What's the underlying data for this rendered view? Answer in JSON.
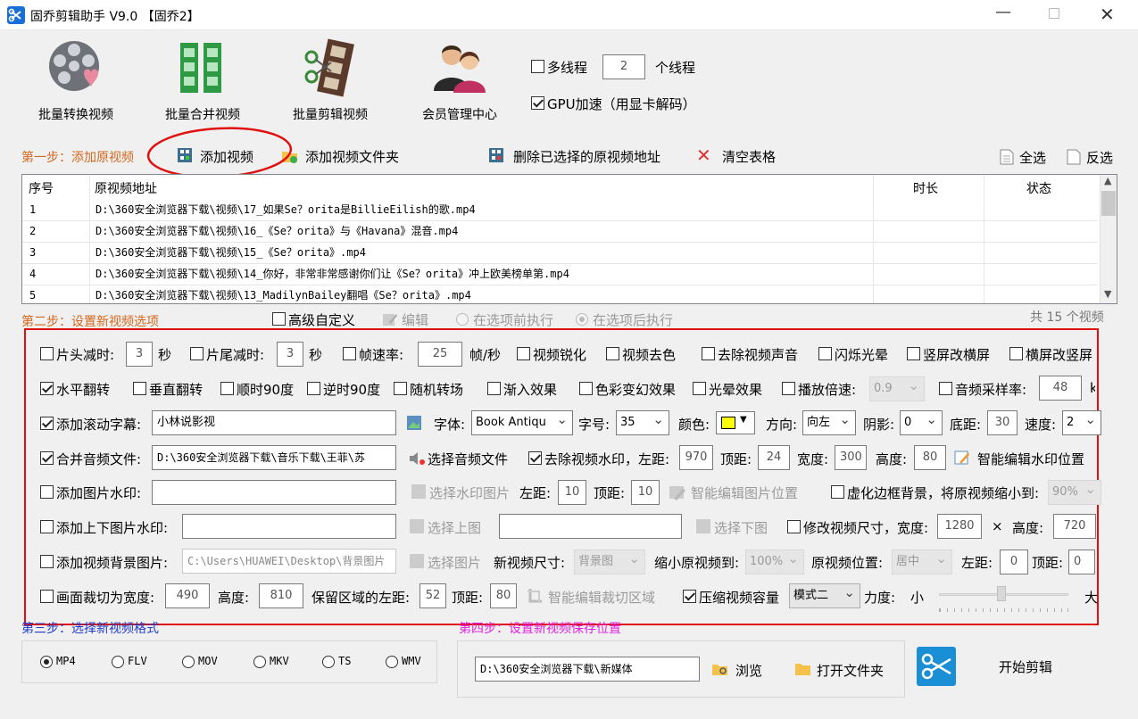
{
  "window": {
    "title": "固乔剪辑助手 V9.0 【固乔2】"
  },
  "toolbar": {
    "convert": "批量转换视频",
    "merge": "批量合并视频",
    "edit": "批量剪辑视频",
    "member": "会员管理中心",
    "multithread": "多线程",
    "threads": "2",
    "threads_unit": "个线程",
    "gpu": "GPU加速（用显卡解码）"
  },
  "step1": {
    "label": "第一步：添加原视频",
    "add_video": "添加视频",
    "add_folder": "添加视频文件夹",
    "delete_selected": "删除已选择的原视频地址",
    "clear": "清空表格",
    "select_all": "全选",
    "invert": "反选"
  },
  "table": {
    "headers": {
      "index": "序号",
      "path": "原视频地址",
      "duration": "时长",
      "status": "状态"
    },
    "rows": [
      {
        "index": "1",
        "path": "D:\\360安全浏览器下载\\视频\\17_如果Se？orita是BillieEilish的歌.mp4"
      },
      {
        "index": "2",
        "path": "D:\\360安全浏览器下载\\视频\\16_《Se？orita》与《Havana》混音.mp4"
      },
      {
        "index": "3",
        "path": "D:\\360安全浏览器下载\\视频\\15_《Se？orita》.mp4"
      },
      {
        "index": "4",
        "path": "D:\\360安全浏览器下载\\视频\\14_你好，非常非常感谢你们让《Se？orita》冲上欧美榜单第.mp4"
      },
      {
        "index": "5",
        "path": "D:\\360安全浏览器下载\\视频\\13_MadilynBailey翻唱《Se？orita》.mp4"
      }
    ]
  },
  "step2": {
    "label": "第二步：设置新视频选项",
    "advanced": "高级自定义",
    "edit": "编辑",
    "before": "在选项前执行",
    "after": "在选项后执行",
    "count": "共 15 个视频"
  },
  "opts": {
    "head_cut": "片头减时:",
    "head_val": "3",
    "sec1": "秒",
    "tail_cut": "片尾减时:",
    "tail_val": "3",
    "sec2": "秒",
    "fps": "帧速率:",
    "fps_val": "25",
    "fps_unit": "帧/秒",
    "sharpen": "视频锐化",
    "decolor": "视频去色",
    "remove_audio": "去除视频声音",
    "flash": "闪烁光晕",
    "to_landscape": "竖屏改横屏",
    "to_portrait": "横屏改竖屏",
    "hflip": "水平翻转",
    "vflip": "垂直翻转",
    "cw90": "顺时90度",
    "ccw90": "逆时90度",
    "random_trans": "随机转场",
    "fade": "渐入效果",
    "color_change": "色彩变幻效果",
    "halo": "光晕效果",
    "speed": "播放倍速:",
    "speed_val": "0.9",
    "sample": "音频采样率:",
    "sample_val": "48",
    "sample_unit": "k",
    "scroll": "添加滚动字幕:",
    "scroll_text": "小林说影视",
    "font": "字体:",
    "font_val": "Book Antiqu",
    "size": "字号:",
    "size_val": "35",
    "color": "颜色:",
    "dir": "方向:",
    "dir_val": "向左",
    "shadow": "阴影:",
    "shadow_val": "0",
    "bottom": "底距:",
    "bottom_val": "30",
    "spd": "速度:",
    "spd_val": "2",
    "merge_audio": "合并音频文件:",
    "audio_path": "D:\\360安全浏览器下载\\音乐下载\\王菲\\苏",
    "choose_audio": "选择音频文件",
    "remove_wm": "去除视频水印，左距:",
    "wm_left": "970",
    "top": "顶距:",
    "wm_top": "24",
    "width": "宽度:",
    "wm_w": "300",
    "height": "高度:",
    "wm_h": "80",
    "smart_wm": "智能编辑水印位置",
    "img_wm": "添加图片水印:",
    "choose_wm": "选择水印图片",
    "left": "左距:",
    "img_left": "10",
    "img_top_lbl": "顶距:",
    "img_top": "10",
    "smart_img": "智能编辑图片位置",
    "blur_bg": "虚化边框背景，将原视频缩小到:",
    "blur_val": "90%",
    "tb_wm": "添加上下图片水印:",
    "choose_top": "选择上图",
    "choose_bottom": "选择下图",
    "resize": "修改视频尺寸，宽度:",
    "res_w": "1280",
    "times": "×",
    "res_h_lbl": "高度:",
    "res_h": "720",
    "bg_img": "添加视频背景图片:",
    "bg_path": "C:\\Users\\HUAWEI\\Desktop\\背景图片",
    "choose_img": "选择图片",
    "new_size": "新视频尺寸:",
    "new_size_val": "背景图",
    "shrink": "缩小原视频到:",
    "shrink_val": "100%",
    "pos": "原视频位置:",
    "pos_val": "居中",
    "pos_left": "左距:",
    "pos_left_val": "0",
    "pos_top": "顶距:",
    "pos_top_val": "0",
    "crop": "画面裁切为宽度:",
    "crop_w": "490",
    "crop_h_lbl": "高度:",
    "crop_h": "810",
    "keep_left": "保留区域的左距:",
    "keep_left_val": "52",
    "keep_top": "顶距:",
    "keep_top_val": "80",
    "smart_crop": "智能编辑裁切区域",
    "compress": "压缩视频容量",
    "mode": "模式二",
    "force": "力度:",
    "small": "小",
    "big": "大"
  },
  "step3": {
    "label": "第三步：选择新视频格式",
    "formats": [
      "MP4",
      "FLV",
      "MOV",
      "MKV",
      "TS",
      "WMV"
    ]
  },
  "step4": {
    "label": "第四步：设置新视频保存位置",
    "path": "D:\\360安全浏览器下载\\新媒体",
    "browse": "浏览",
    "open_folder": "打开文件夹",
    "start": "开始剪辑"
  },
  "colors": {
    "section_orange": "#d2691e",
    "section_blue": "#1e3cc8",
    "section_magenta": "#e020e0",
    "annotation_red": "#e01010",
    "subtitle_color": "#ffff00"
  }
}
